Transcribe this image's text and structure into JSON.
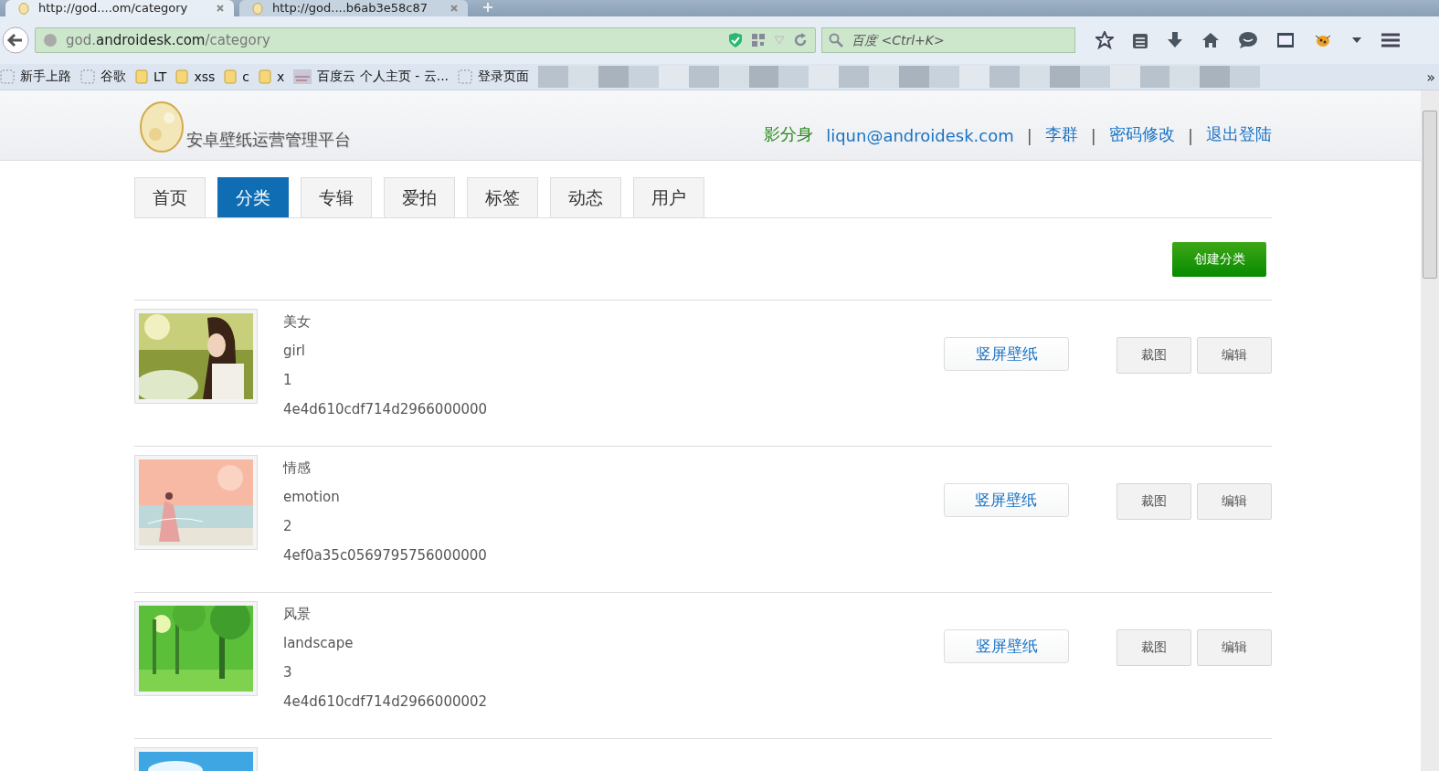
{
  "browser": {
    "tabs": [
      {
        "title": "http://god....om/category",
        "selected": true
      },
      {
        "title": "http://god....b6ab3e58c87",
        "selected": false
      }
    ],
    "address": {
      "host_prefix": "god.",
      "domain": "androidesk.com",
      "path": "/category"
    },
    "search": {
      "placeholder": "百度 <Ctrl+K>"
    },
    "bookmarks": [
      {
        "label": "新手上路",
        "kind": "page"
      },
      {
        "label": "谷歌",
        "kind": "page"
      },
      {
        "label": "LT",
        "kind": "folder"
      },
      {
        "label": "xss",
        "kind": "folder"
      },
      {
        "label": "c",
        "kind": "folder"
      },
      {
        "label": "x",
        "kind": "folder"
      },
      {
        "label": "百度云 个人主页 - 云...",
        "kind": "thumb"
      },
      {
        "label": "登录页面",
        "kind": "page"
      }
    ],
    "overflow": "»"
  },
  "header": {
    "site_title": "安卓壁纸运营管理平台",
    "role": "影分身",
    "email": "liqun@androidesk.com",
    "links": [
      "李群",
      "密码修改",
      "退出登陆"
    ],
    "separator": "|"
  },
  "nav_tabs": [
    {
      "label": "首页",
      "selected": false
    },
    {
      "label": "分类",
      "selected": true
    },
    {
      "label": "专辑",
      "selected": false
    },
    {
      "label": "爱拍",
      "selected": false
    },
    {
      "label": "标签",
      "selected": false
    },
    {
      "label": "动态",
      "selected": false
    },
    {
      "label": "用户",
      "selected": false
    }
  ],
  "create_button": "创建分类",
  "categories": [
    {
      "name": "美女",
      "en": "girl",
      "order": "1",
      "id": "4e4d610cdf714d2966000000",
      "type_button": "竖屏壁纸",
      "crop_button": "裁图",
      "edit_button": "编辑"
    },
    {
      "name": "情感",
      "en": "emotion",
      "order": "2",
      "id": "4ef0a35c0569795756000000",
      "type_button": "竖屏壁纸",
      "crop_button": "裁图",
      "edit_button": "编辑"
    },
    {
      "name": "风景",
      "en": "landscape",
      "order": "3",
      "id": "4e4d610cdf714d2966000002",
      "type_button": "竖屏壁纸",
      "crop_button": "裁图",
      "edit_button": "编辑"
    },
    {
      "kind": "picture"
    }
  ]
}
